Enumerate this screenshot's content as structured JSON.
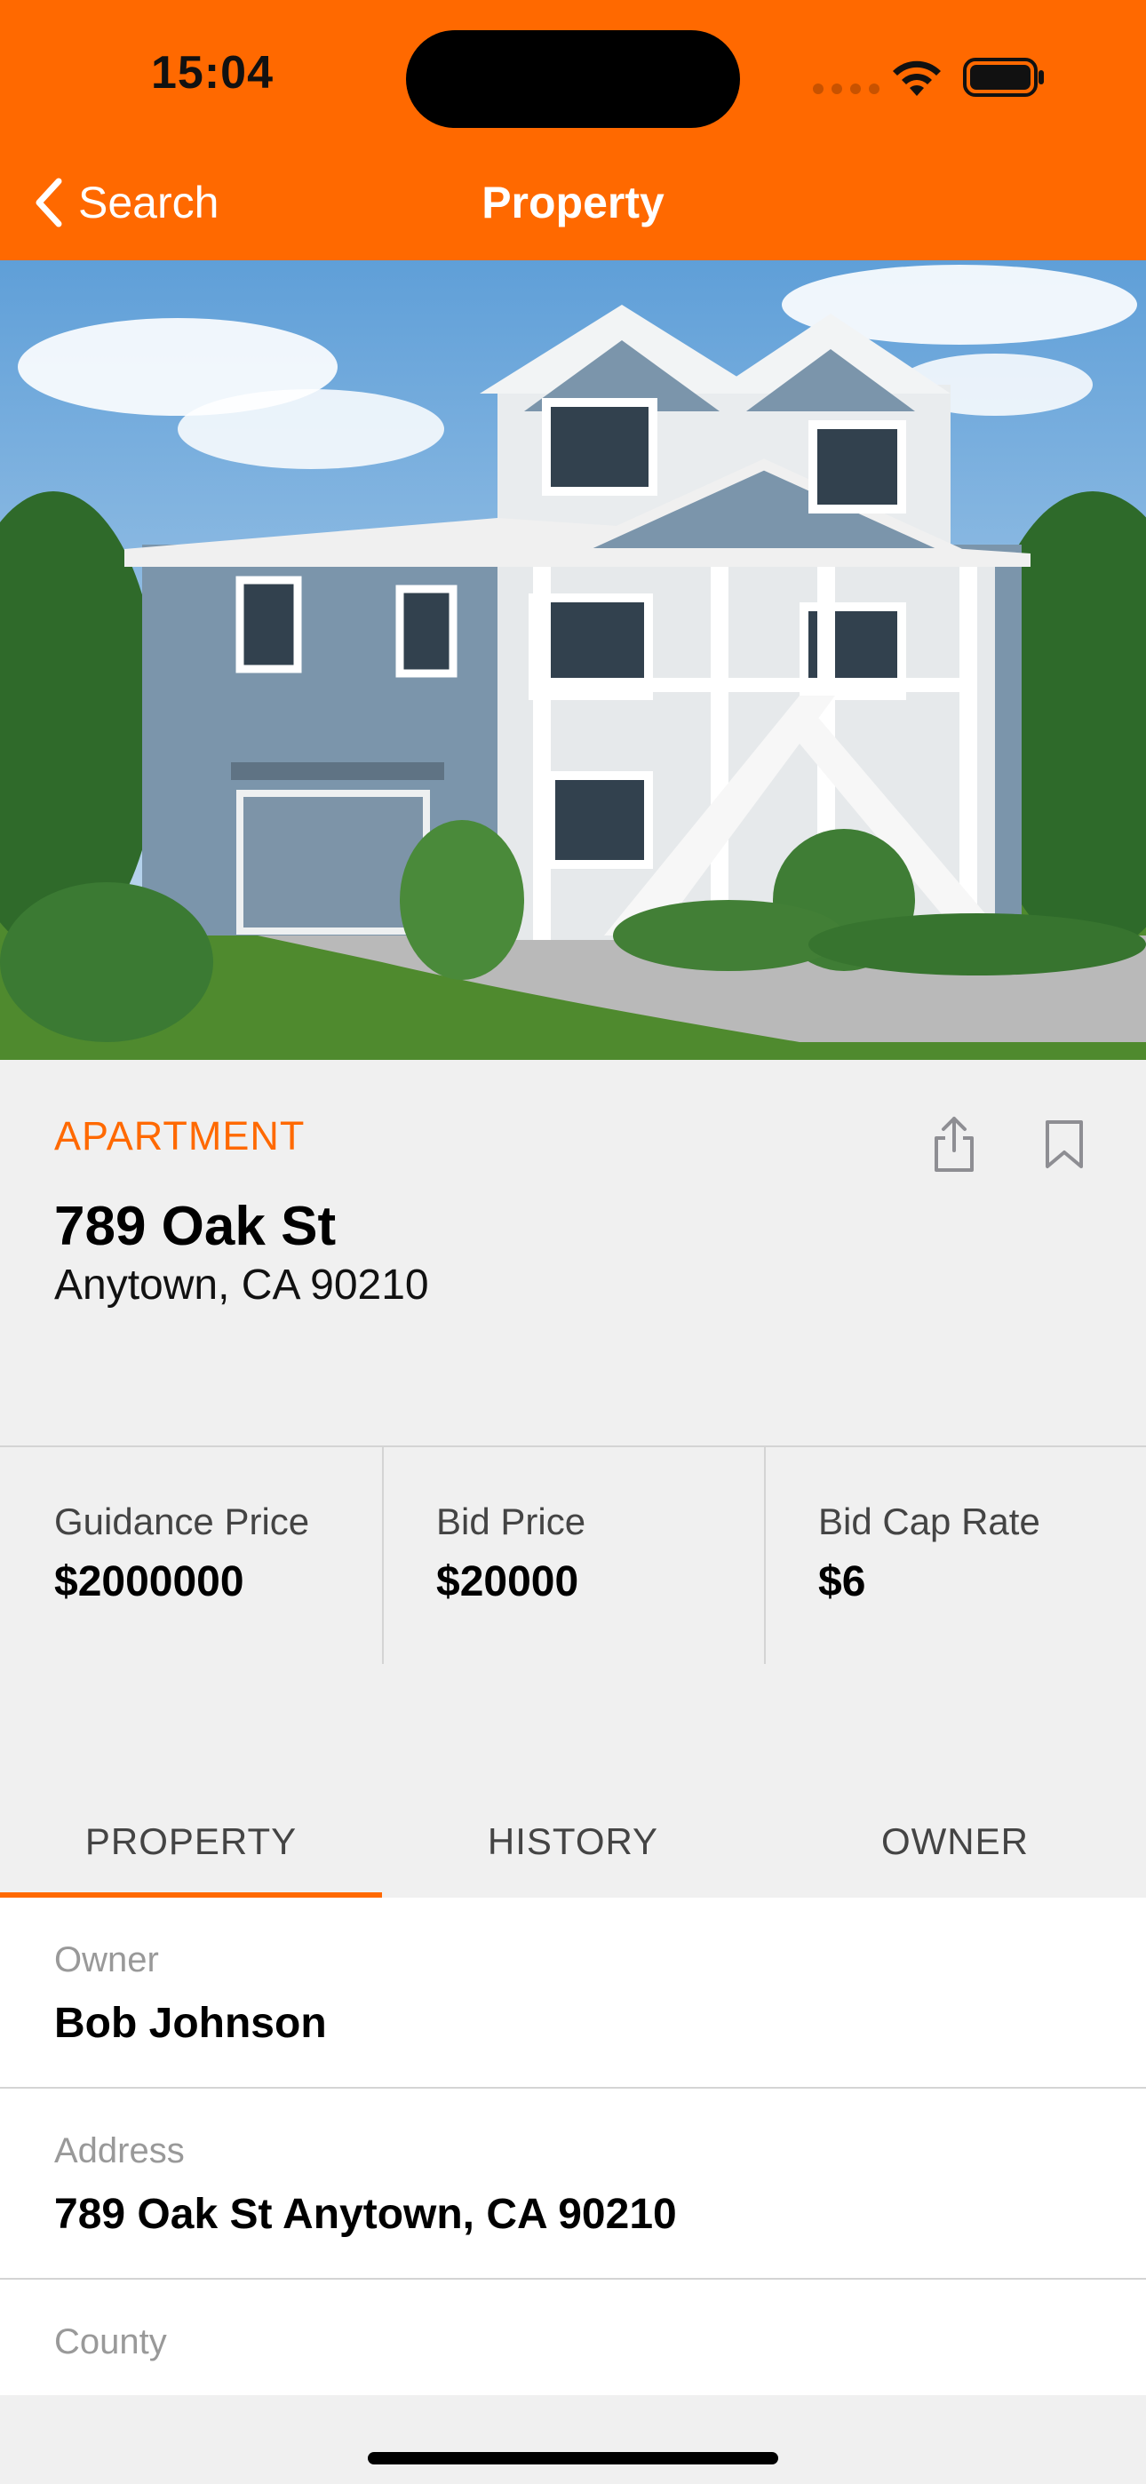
{
  "status_bar": {
    "time": "15:04"
  },
  "nav": {
    "back_label": "Search",
    "title": "Property"
  },
  "listing": {
    "type": "APARTMENT",
    "street": "789 Oak St",
    "city_line": "Anytown, CA 90210"
  },
  "prices": [
    {
      "label": "Guidance Price",
      "value": "$2000000"
    },
    {
      "label": "Bid Price",
      "value": "$20000"
    },
    {
      "label": "Bid Cap Rate",
      "value": "$6"
    }
  ],
  "tabs": [
    {
      "label": "PROPERTY",
      "active": true
    },
    {
      "label": "HISTORY",
      "active": false
    },
    {
      "label": "OWNER",
      "active": false
    }
  ],
  "details": [
    {
      "label": "Owner",
      "value": "Bob Johnson"
    },
    {
      "label": "Address",
      "value": "789 Oak St Anytown, CA 90210"
    },
    {
      "label": "County",
      "value": ""
    }
  ],
  "colors": {
    "accent": "#ff6900",
    "background": "#f0f0f0"
  }
}
